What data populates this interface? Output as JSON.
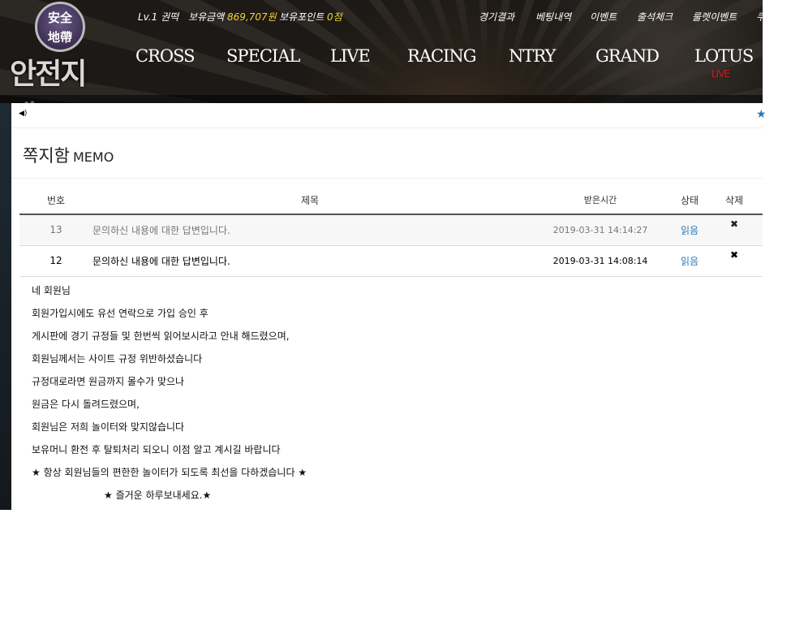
{
  "header": {
    "logo": {
      "emblem_line1": "安全",
      "emblem_line2": "地帶",
      "brand": "안전지대"
    },
    "user": {
      "level": "Lv.1 권떡",
      "money_label": "보유금액",
      "money_value": "869,707원",
      "point_label": "보유포인트",
      "point_value": "0점"
    },
    "top_links": [
      "경기결과",
      "베팅내역",
      "이벤트",
      "출석체크",
      "룰렛이벤트",
      "쿠"
    ],
    "nav": [
      "CROSS",
      "SPECIAL",
      "LIVE",
      "RACING",
      "NTRY",
      "GRAND",
      "LOTUS"
    ],
    "lotus_badge": "LIVE",
    "colors": {
      "accent_yellow": "#f2d430",
      "live_red": "#d01818"
    }
  },
  "notice": {
    "icon": "speaker-icon",
    "right_icon": "star-icon"
  },
  "page": {
    "title": "쪽지함",
    "subtitle": "MEMO"
  },
  "table": {
    "headers": [
      "번호",
      "제목",
      "받은시간",
      "상태",
      "삭제"
    ],
    "rows": [
      {
        "no": "13",
        "subject": "문의하신 내용에 대한 답변입니다.",
        "time": "2019-03-31 14:14:27",
        "status": "읽음",
        "delete": "✖"
      },
      {
        "no": "12",
        "subject": "문의하신 내용에 대한 답변입니다.",
        "time": "2019-03-31 14:08:14",
        "status": "읽음",
        "delete": "✖"
      }
    ]
  },
  "message": {
    "lines": [
      "네 회원님",
      "회원가입시에도 유선 연락으로 가입 승인 후",
      "게시판에 경기 규정들 및 한번씩 읽어보시라고 안내 해드렸으며,",
      "회원님께서는 사이트 규정 위반하셨습니다",
      "규정대로라면 원금까지 몰수가 맞으나",
      "원금은 다시 돌려드렸으며,",
      "회원님은 저희 놀이터와 맞지않습니다",
      "보유머니 환전 후 탈퇴처리 되오니 이점 알고 계시길 바랍니다",
      "★ 항상 회원님들의 편한한 놀이터가 되도록 최선을 다하겠습니다 ★",
      "★ 즐거운 하루보내세요.★"
    ]
  }
}
